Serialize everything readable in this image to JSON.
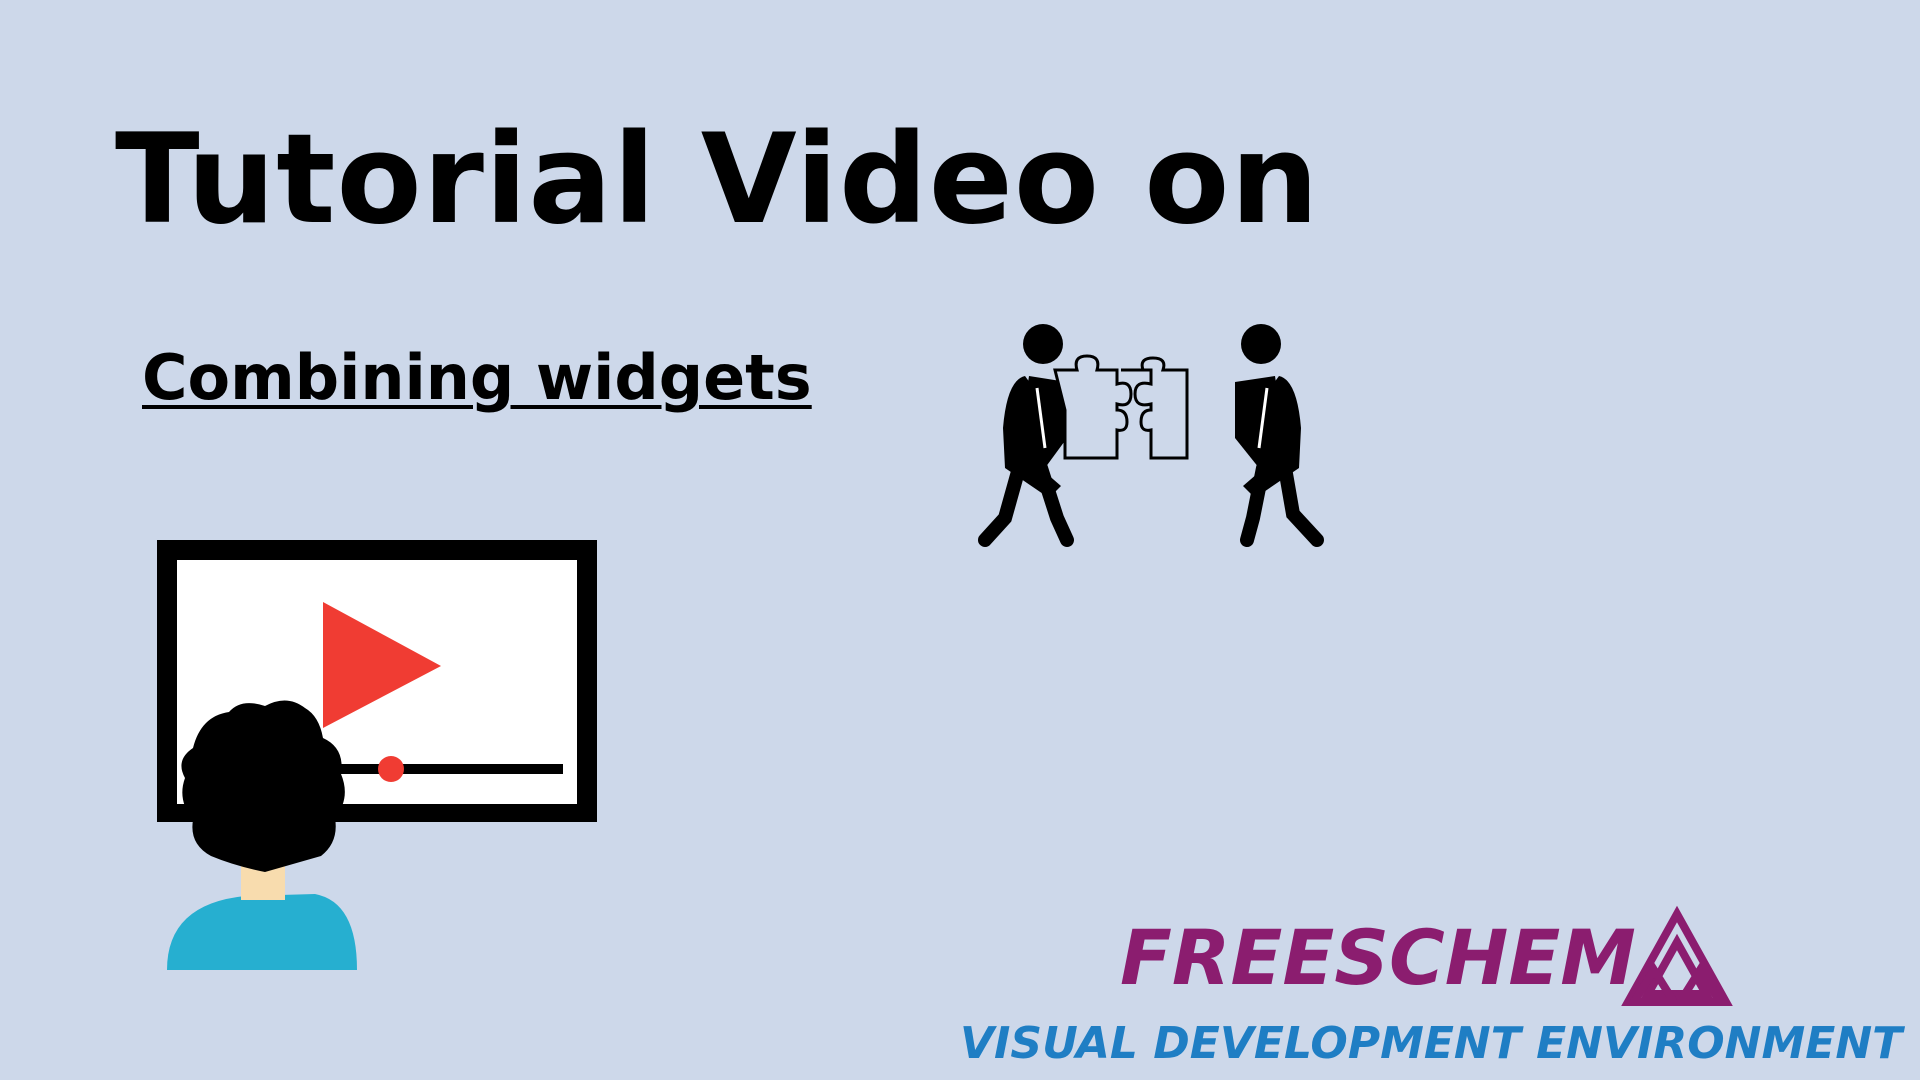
{
  "title": "Tutorial Video on",
  "subtitle": "Combining widgets",
  "brand": {
    "name": "FREESCHEM",
    "tagline": "VISUAL DEVELOPMENT ENVIRONMENT",
    "name_color": "#8b1d6f",
    "tagline_color": "#1f7ec4",
    "logo_color": "#8b1d6f"
  },
  "icons": {
    "collaboration": "people-combining-puzzle-icon",
    "video": "person-watching-video-icon",
    "logo": "freeschem-triangle-logo-icon"
  },
  "colors": {
    "background": "#cdd8ea",
    "play_button": "#f03c33",
    "shirt": "#26afd0",
    "skin": "#f8dcae"
  }
}
